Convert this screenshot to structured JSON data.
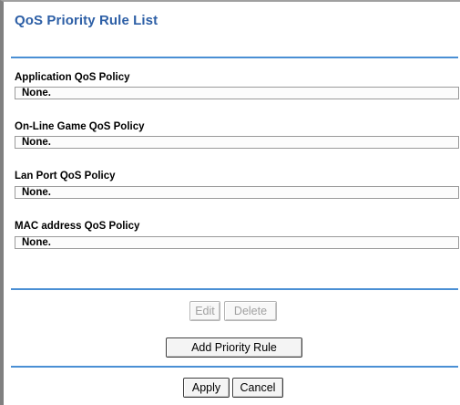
{
  "page": {
    "title": "QoS Priority Rule List"
  },
  "sections": {
    "application": {
      "label": "Application QoS Policy",
      "value": "None."
    },
    "online_game": {
      "label": "On-Line Game QoS Policy",
      "value": "None."
    },
    "lan_port": {
      "label": "Lan Port QoS Policy",
      "value": "None."
    },
    "mac_address": {
      "label": "MAC address QoS Policy",
      "value": "None."
    }
  },
  "buttons": {
    "edit": "Edit",
    "delete": "Delete",
    "add_priority_rule": "Add Priority Rule",
    "apply": "Apply",
    "cancel": "Cancel"
  },
  "colors": {
    "title": "#2d5fa6",
    "divider": "#4a8fd4"
  }
}
